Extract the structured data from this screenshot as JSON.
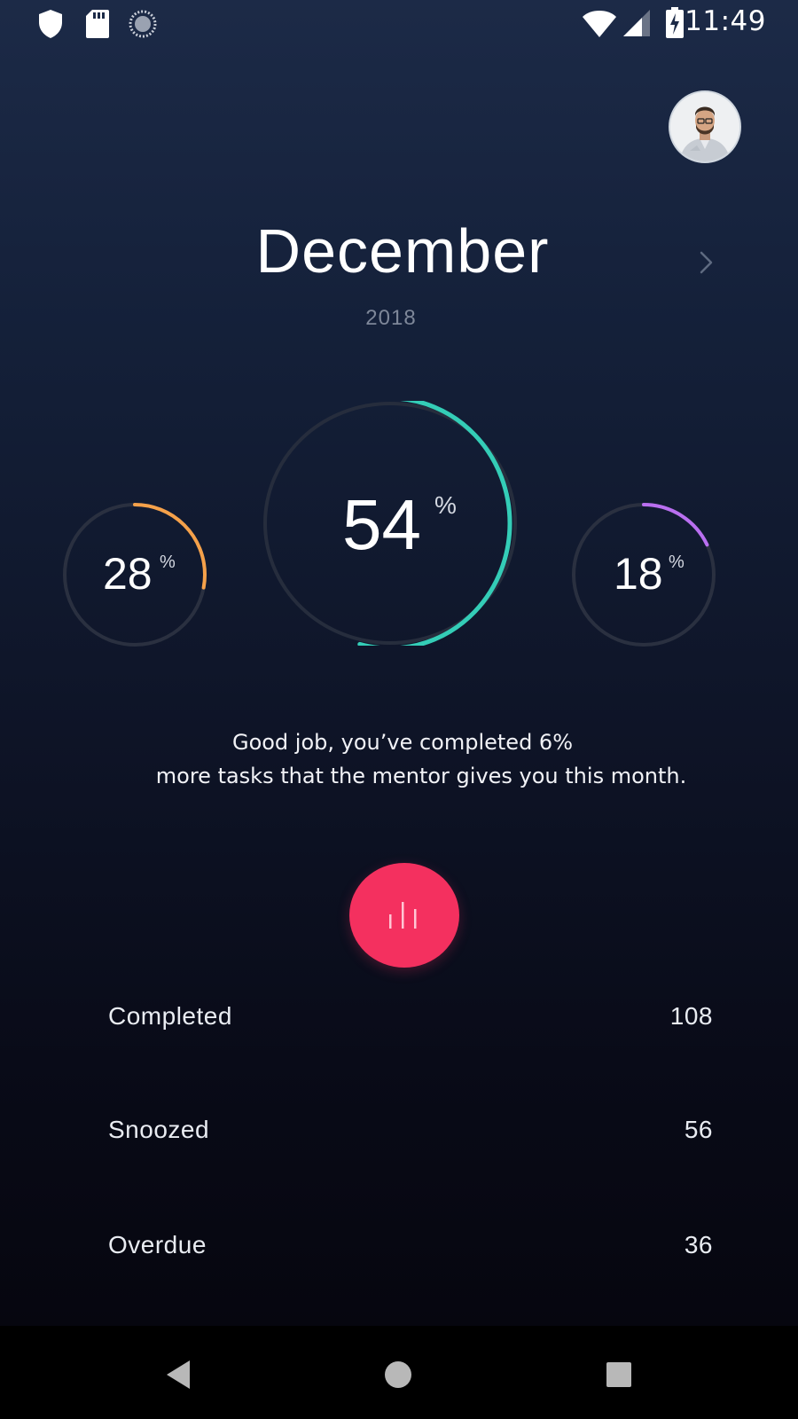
{
  "status_bar": {
    "time": "11:49",
    "left_icons": [
      "shield-icon",
      "sd-card-icon",
      "sync-icon"
    ],
    "right_icons": [
      "wifi-icon",
      "cell-signal-icon",
      "battery-charging-icon"
    ]
  },
  "header": {
    "month": "December",
    "year": "2018",
    "next_icon": "chevron-right-icon",
    "avatar_icon": "user-avatar"
  },
  "gauges": [
    {
      "id": "left",
      "value": "28",
      "unit": "%",
      "fraction": 0.28,
      "color": "#f5a14a"
    },
    {
      "id": "center",
      "value": "54",
      "unit": "%",
      "fraction": 0.54,
      "color": "#34cdb7"
    },
    {
      "id": "right",
      "value": "18",
      "unit": "%",
      "fraction": 0.18,
      "color": "#b96ff0"
    }
  ],
  "message": {
    "line1": "Good job, you’ve completed 6%",
    "line2": "more tasks that the mentor gives you this month."
  },
  "fab": {
    "icon": "bar-chart-icon",
    "color": "#f4305f"
  },
  "stats": [
    {
      "label": "Completed",
      "value": "108"
    },
    {
      "label": "Snoozed",
      "value": "56"
    },
    {
      "label": "Overdue",
      "value": "36"
    }
  ],
  "nav_bar": {
    "icons": [
      "back-icon",
      "home-icon",
      "recents-icon"
    ]
  }
}
